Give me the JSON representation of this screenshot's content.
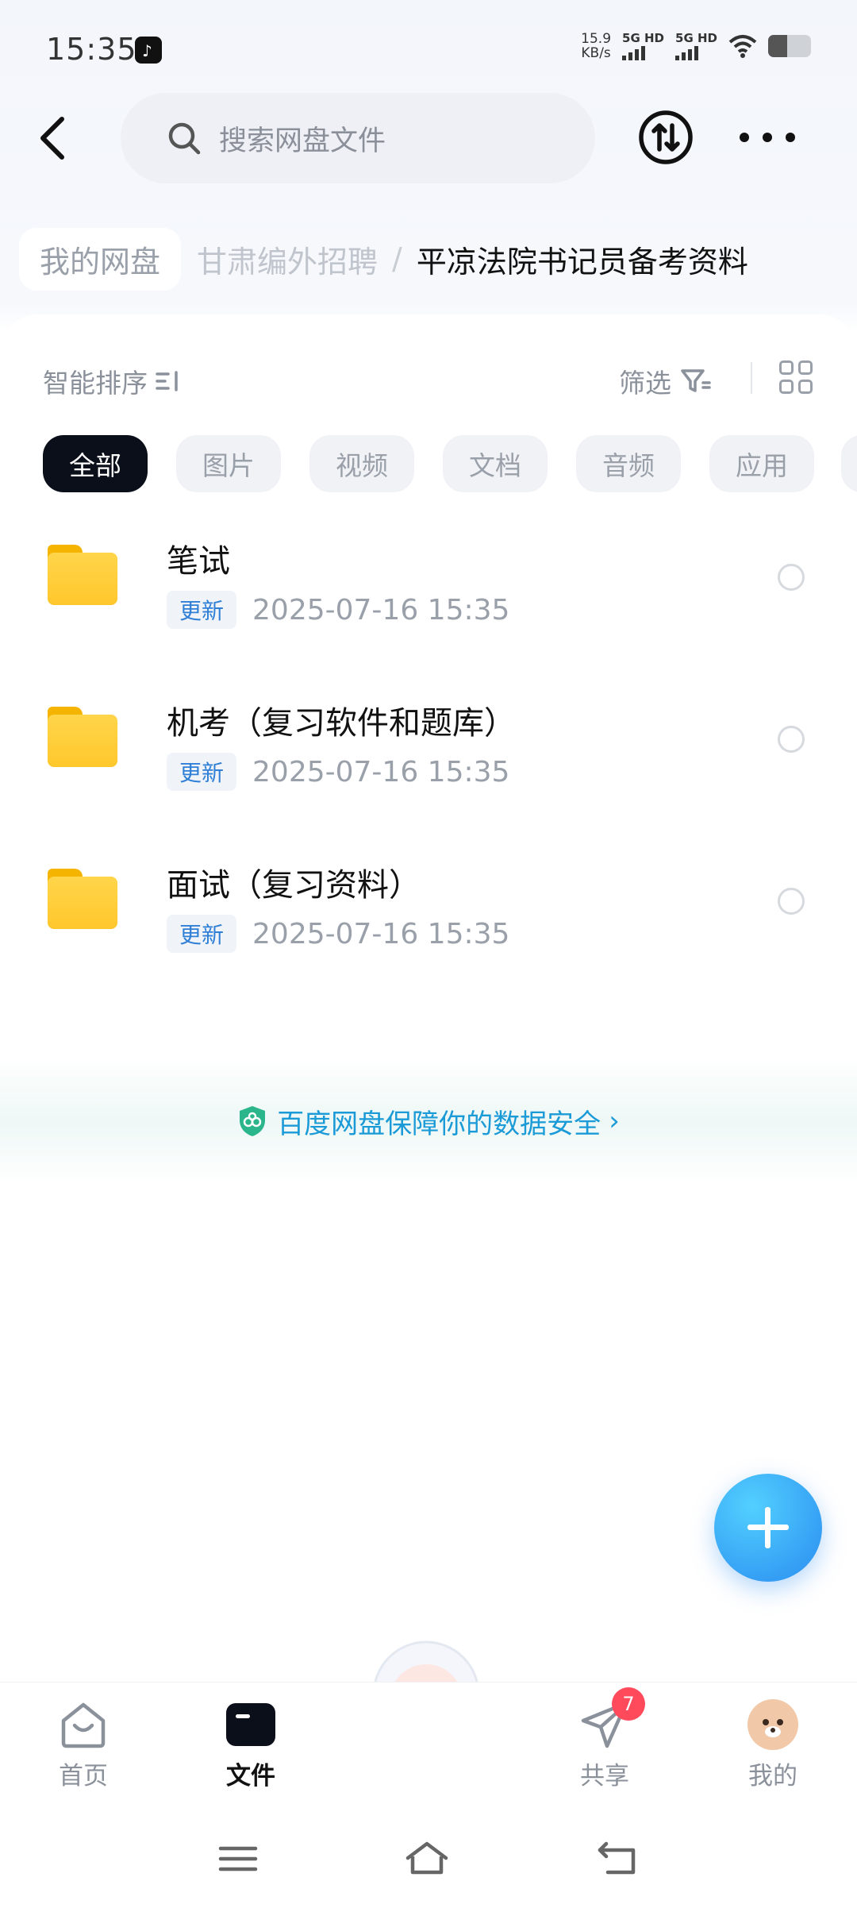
{
  "status_bar": {
    "time": "15:35",
    "speed_value": "15.9",
    "speed_unit": "KB/s",
    "sim1_label": "5G HD",
    "sim2_label": "5G HD",
    "battery_level": 0.45,
    "icons": [
      "tiktok-app-icon",
      "signal-icon",
      "wifi-icon",
      "battery-icon"
    ]
  },
  "header": {
    "search_placeholder": "搜索网盘文件",
    "icons": [
      "back-arrow-icon",
      "search-icon",
      "transfer-icon",
      "more-icon"
    ]
  },
  "breadcrumb": {
    "root": "我的网盘",
    "middle": "甘肃编外招聘",
    "separator": "/",
    "current": "平凉法院书记员备考资料"
  },
  "toolbar": {
    "sort_label": "智能排序",
    "filter_label": "筛选"
  },
  "filters": [
    {
      "label": "全部",
      "active": true
    },
    {
      "label": "图片",
      "active": false
    },
    {
      "label": "视频",
      "active": false
    },
    {
      "label": "文档",
      "active": false
    },
    {
      "label": "音频",
      "active": false
    },
    {
      "label": "应用",
      "active": false
    }
  ],
  "files": [
    {
      "name": "笔试",
      "badge": "更新",
      "date": "2025-07-16  15:35"
    },
    {
      "name": "机考（复习软件和题库）",
      "badge": "更新",
      "date": "2025-07-16  15:35"
    },
    {
      "name": "面试（复习资料）",
      "badge": "更新",
      "date": "2025-07-16  15:35"
    }
  ],
  "safety_banner": {
    "text": "百度网盘保障你的数据安全",
    "arrow": "›"
  },
  "bottom_nav": {
    "items": [
      {
        "label": "首页",
        "icon": "home-icon"
      },
      {
        "label": "文件",
        "icon": "folder-icon",
        "active": true
      },
      {
        "label": "共享",
        "icon": "share-plane-icon",
        "badge": "7"
      },
      {
        "label": "我的",
        "icon": "avatar-icon"
      }
    ]
  },
  "colors": {
    "accent": "#2a8cf0",
    "badge_red": "#ff4a5c",
    "folder_yellow": "#ffc72c",
    "safety_text": "#1a9ad6"
  }
}
